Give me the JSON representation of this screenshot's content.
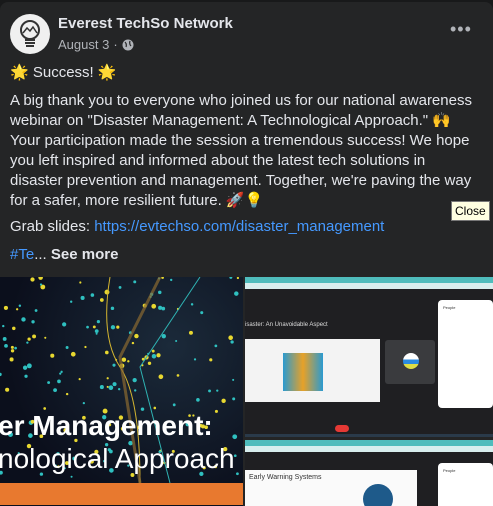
{
  "post": {
    "author": "Everest TechSo Network",
    "date": "August 3",
    "separator": "·",
    "privacy_icon": "globe-icon",
    "more_icon": "ellipsis-icon",
    "title_line": "🌟 Success! 🌟",
    "body_lines": [
      "A big thank you to everyone who joined us for our national awareness",
      "webinar on \"Disaster Management: A Technological Approach.\" 🙌",
      "Your participation made the session a tremendous success! We hope",
      "you left inspired and informed about the latest tech solutions in",
      "disaster prevention and management. Together, we're paving the way",
      "for a safer, more resilient future. 🚀💡"
    ],
    "slides_label": "Grab slides: ",
    "slides_link": "https://evtechso.com/disaster_management",
    "hashtag": "#Te",
    "ellipsis": "...",
    "see_more": "See more"
  },
  "tooltip": "Close",
  "images": {
    "cover_line1": "er Management:",
    "cover_line2": "nological Approach",
    "screenshot1_slide_title": "isaster: An Unavoidable Aspect",
    "screenshot1_people": "People",
    "screenshot2_slide_title": "Early Warning Systems",
    "screenshot2_people": "People"
  },
  "colors": {
    "background": "#242526",
    "text": "#e4e6eb",
    "secondary": "#b0b3b8",
    "link": "#4599ff",
    "accent_orange": "#e8792f"
  }
}
